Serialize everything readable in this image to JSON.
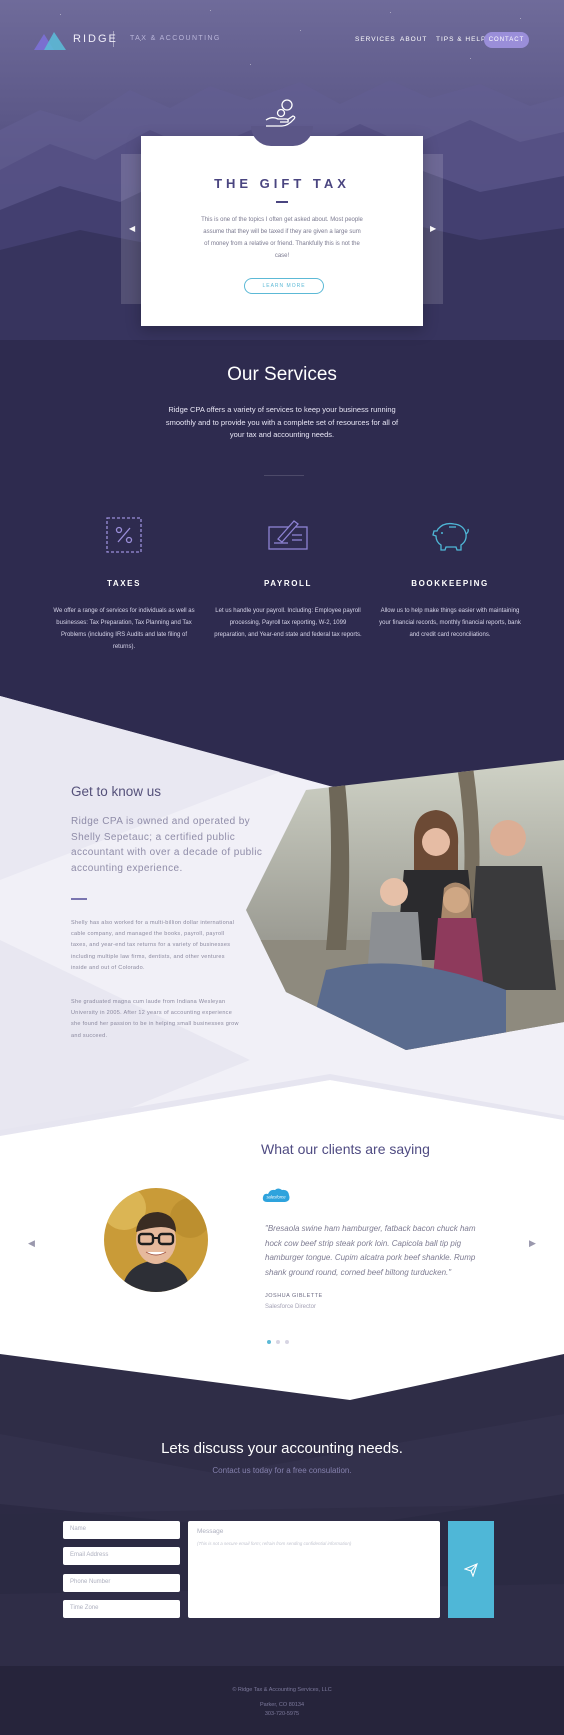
{
  "nav": {
    "brand": "RIDGE",
    "tagline": "TAX & ACCOUNTING",
    "links": [
      "SERVICES",
      "ABOUT",
      "TIPS & HELP"
    ],
    "contact": "CONTACT"
  },
  "hero": {
    "title": "THE GIFT TAX",
    "body": "This is one of the topics I often get asked about. Most people assume that they will be taxed if they are given a large sum of money from a relative or friend. Thankfully this is not the case!",
    "button": "LEARN MORE"
  },
  "services": {
    "title": "Our Services",
    "intro": "Ridge CPA offers a variety of services to keep your business running smoothly and to provide you with a complete set of resources for all of your tax and accounting needs.",
    "items": [
      {
        "title": "TAXES",
        "text": "We offer a range of services for individuals as well as businesses: Tax Preparation, Tax Planning and Tax Problems (including IRS Audits and late filing of returns).",
        "icon": "percent-icon"
      },
      {
        "title": "PAYROLL",
        "text": "Let us handle your payroll. Including: Employee payroll processing, Payroll tax reporting, W-2, 1099 preparation, and Year-end state and federal tax reports.",
        "icon": "check-pen-icon"
      },
      {
        "title": "BOOKKEEPING",
        "text": "Allow us to help make things easier with maintaining your financial records, monthly financial reports, bank and credit card reconciliations.",
        "icon": "piggy-bank-icon"
      }
    ]
  },
  "about": {
    "title": "Get to know us",
    "lead": "Ridge CPA is owned and operated by Shelly Sepetauc; a certified public accountant with over a decade of public accounting experience.",
    "p1": "Shelly has also worked for a multi-billion dollar international cable company, and managed the books, payroll, payroll taxes, and year-end tax returns for a variety of businesses including multiple law firms, dentists, and other ventures inside and out of Colorado.",
    "p2": "She graduated magna cum laude from Indiana Wesleyan University in 2005. After 12 years of accounting experience she found her passion to be in helping small businesses grow and succeed."
  },
  "testimonial": {
    "title": "What our clients are saying",
    "logo": "salesforce",
    "quote": "\"Bresaola swine ham hamburger, fatback bacon chuck ham hock cow beef strip steak pork loin. Capicola ball tip pig hamburger tongue. Cupim alcatra pork beef shankle. Rump shank ground round, corned beef biltong turducken.\"",
    "name": "JOSHUA GIBLETTE",
    "role": "Salesforce Director"
  },
  "contact": {
    "title": "Lets discuss your accounting needs.",
    "subtitle": "Contact us today for a free consulation.",
    "fields": [
      "Name",
      "Email Address",
      "Phone Number",
      "Time Zone"
    ],
    "message_placeholder": "Message",
    "message_note": "(This is not a secure email form; refrain from sending confidential information)"
  },
  "footer": {
    "copyright": "© Ridge Tax & Accounting Services, LLC",
    "city": "Parker, CO 80134",
    "phone": "303-720-5975"
  },
  "colors": {
    "accent": "#9a8ed9",
    "teal": "#4fb7d7",
    "navy": "#2e2b4f"
  }
}
